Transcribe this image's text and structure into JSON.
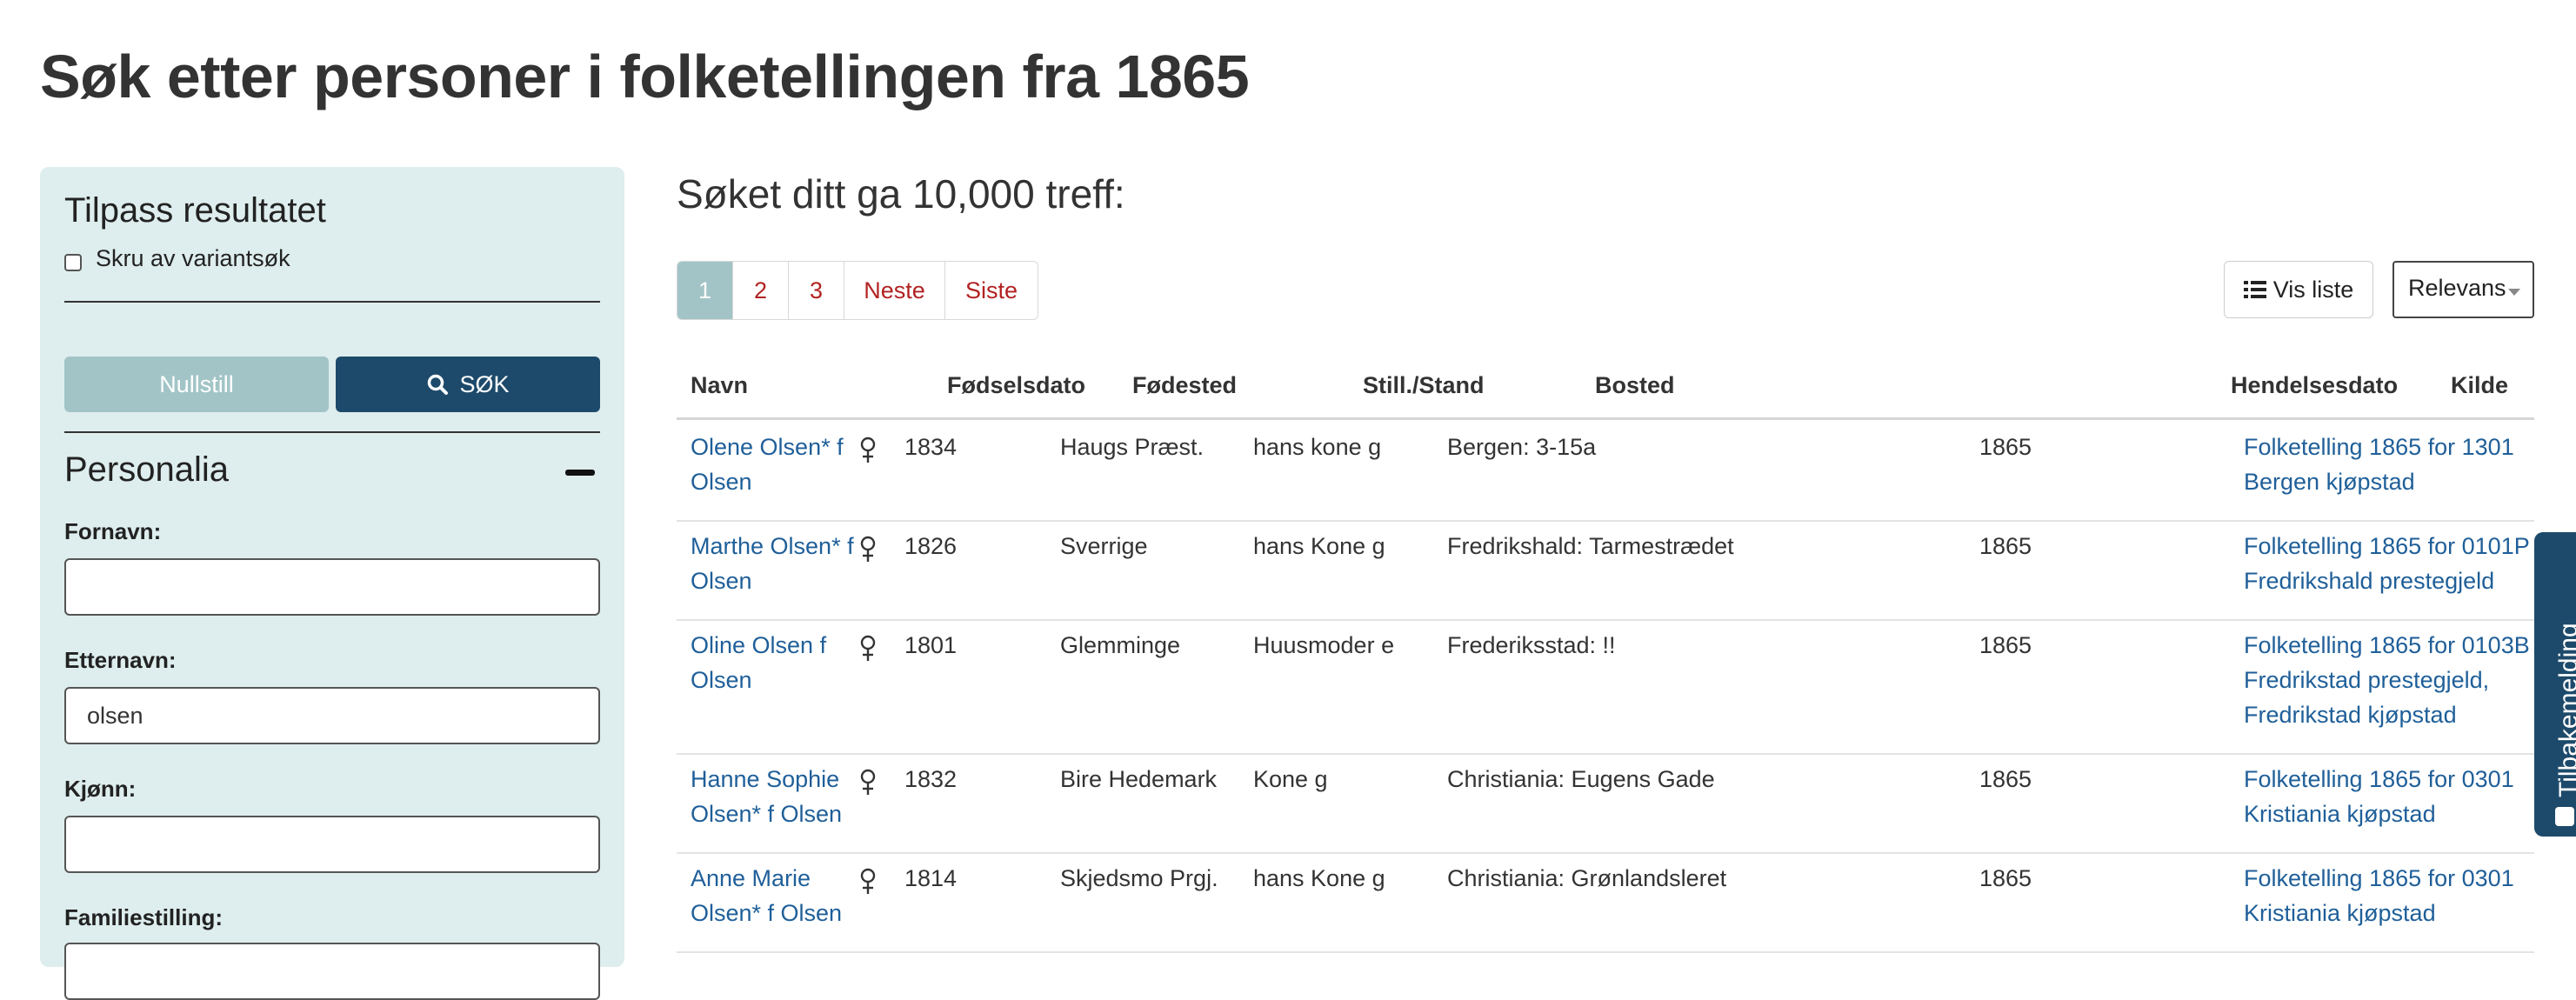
{
  "page": {
    "title": "Søk etter personer i folketellingen fra 1865"
  },
  "sidebar": {
    "heading": "Tilpass resultatet",
    "variant_label": "Skru av variantsøk",
    "reset_label": "Nullstill",
    "search_label": "SØK",
    "section_title": "Personalia",
    "fields": {
      "first_name_label": "Fornavn:",
      "first_name_value": "",
      "last_name_label": "Etternavn:",
      "last_name_value": "olsen",
      "gender_label": "Kjønn:",
      "gender_value": "",
      "family_label": "Familiestilling:"
    }
  },
  "results": {
    "heading": "Søket ditt ga 10,000 treff:",
    "pagination": [
      "1",
      "2",
      "3",
      "Neste",
      "Siste"
    ],
    "active_page": "1",
    "view_list_label": "Vis liste",
    "sort_label": "Relevans",
    "columns": {
      "name": "Navn",
      "birth_date": "Fødselsdato",
      "birth_place": "Fødested",
      "position": "Still./Stand",
      "residence": "Bosted",
      "event_date": "Hendelsesdato",
      "source": "Kilde"
    },
    "rows": [
      {
        "name": "Olene Olsen* f\nOlsen",
        "gender": "female",
        "birth": "1834",
        "place": "Haugs Præst.",
        "position": "hans kone g",
        "residence": "Bergen: 3-15a",
        "event": "1865",
        "source": "Folketelling 1865 for 1301\nBergen kjøpstad"
      },
      {
        "name": "Marthe Olsen* f\nOlsen",
        "gender": "female",
        "birth": "1826",
        "place": "Sverrige",
        "position": "hans Kone g",
        "residence": "Fredrikshald: Tarmestrædet",
        "event": "1865",
        "source": "Folketelling 1865 for 0101P\nFredrikshald prestegjeld"
      },
      {
        "name": "Oline Olsen f\nOlsen",
        "gender": "female",
        "birth": "1801",
        "place": "Glemminge",
        "position": "Huusmoder e",
        "residence": "Frederiksstad: !!",
        "event": "1865",
        "source": "Folketelling 1865 for 0103B\nFredrikstad prestegjeld,\nFredrikstad kjøpstad"
      },
      {
        "name": "Hanne Sophie\nOlsen* f Olsen",
        "gender": "female",
        "birth": "1832",
        "place": "Bire Hedemark",
        "position": "Kone g",
        "residence": "Christiania: Eugens Gade",
        "event": "1865",
        "source": "Folketelling 1865 for 0301\nKristiania kjøpstad"
      },
      {
        "name": "Anne Marie\nOlsen* f Olsen",
        "gender": "female",
        "birth": "1814",
        "place": "Skjedsmo Prgj.",
        "position": "hans Kone g",
        "residence": "Christiania: Grønlandsleret",
        "event": "1865",
        "source": "Folketelling 1865 for 0301\nKristiania kjøpstad"
      }
    ]
  },
  "feedback": {
    "label": "Tilbakemelding"
  },
  "colors": {
    "sidebar_bg": "#deeded",
    "primary": "#1d4a6b",
    "muted_button": "#a2c4c7",
    "link": "#1f5f99",
    "pager_link": "#b22222"
  }
}
